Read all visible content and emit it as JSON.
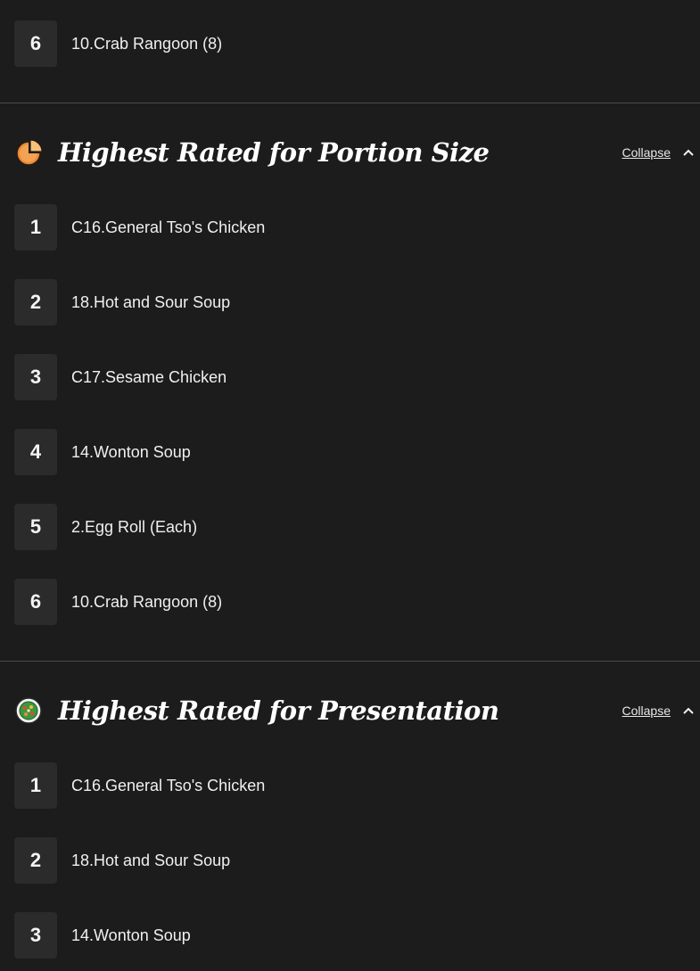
{
  "top_partial": {
    "rank": "6",
    "name": "10.Crab Rangoon (8)"
  },
  "sections": [
    {
      "title": "Highest Rated for Portion Size",
      "icon": "pie-chart-icon",
      "collapse_label": "Collapse",
      "items": [
        {
          "rank": "1",
          "name": "C16.General Tso's Chicken"
        },
        {
          "rank": "2",
          "name": "18.Hot and Sour Soup"
        },
        {
          "rank": "3",
          "name": "C17.Sesame Chicken"
        },
        {
          "rank": "4",
          "name": "14.Wonton Soup"
        },
        {
          "rank": "5",
          "name": "2.Egg Roll (Each)"
        },
        {
          "rank": "6",
          "name": "10.Crab Rangoon (8)"
        }
      ]
    },
    {
      "title": "Highest Rated for Presentation",
      "icon": "garnished-plate-icon",
      "collapse_label": "Collapse",
      "items": [
        {
          "rank": "1",
          "name": "C16.General Tso's Chicken"
        },
        {
          "rank": "2",
          "name": "18.Hot and Sour Soup"
        },
        {
          "rank": "3",
          "name": "14.Wonton Soup"
        }
      ]
    }
  ]
}
